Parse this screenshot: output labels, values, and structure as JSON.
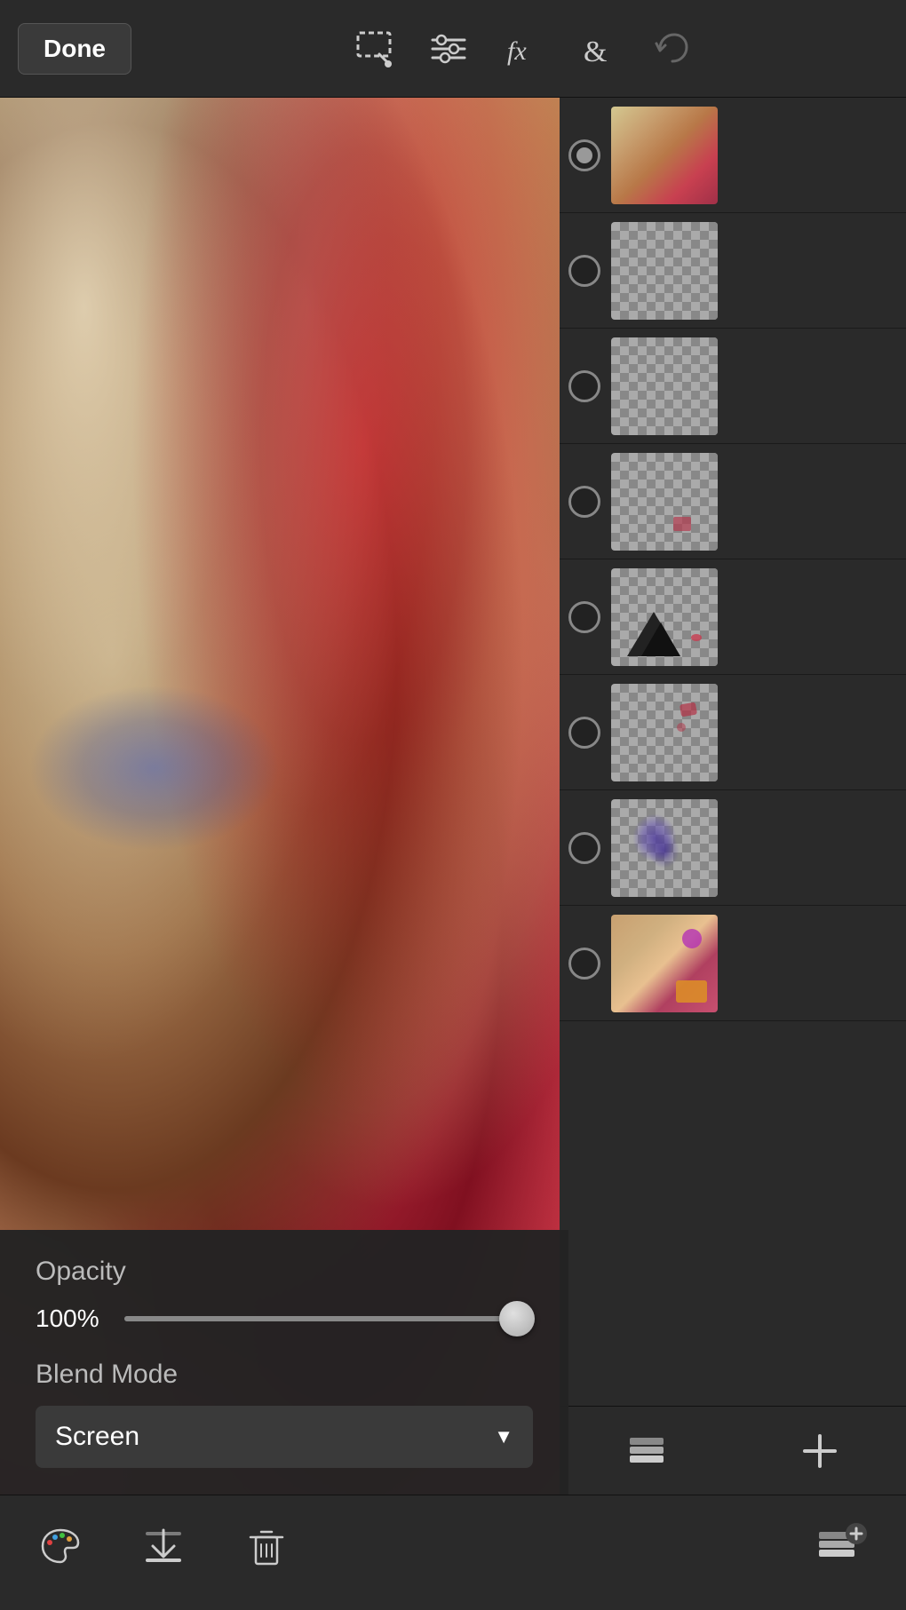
{
  "toolbar": {
    "done_label": "Done",
    "undo_label": "↩"
  },
  "layers": [
    {
      "id": 1,
      "selected": true,
      "type": "colored",
      "color1": "#c8a882",
      "color2": "#d4a070"
    },
    {
      "id": 2,
      "selected": false,
      "type": "transparent"
    },
    {
      "id": 3,
      "selected": false,
      "type": "transparent"
    },
    {
      "id": 4,
      "selected": false,
      "type": "transparent_small"
    },
    {
      "id": 5,
      "selected": false,
      "type": "mountain"
    },
    {
      "id": 6,
      "selected": false,
      "type": "transparent_dots"
    },
    {
      "id": 7,
      "selected": false,
      "type": "flower"
    },
    {
      "id": 8,
      "selected": false,
      "type": "art"
    }
  ],
  "opacity": {
    "label": "Opacity",
    "value": "100%",
    "percent": 100
  },
  "blend": {
    "label": "Blend Mode",
    "current": "Screen",
    "dropdown_arrow": "▼"
  },
  "bottom_toolbar": {
    "palette_icon": "🎨",
    "download_icon": "⬇",
    "trash_icon": "🗑"
  },
  "layers_panel": {
    "layers_icon": "layers",
    "add_icon": "+"
  }
}
